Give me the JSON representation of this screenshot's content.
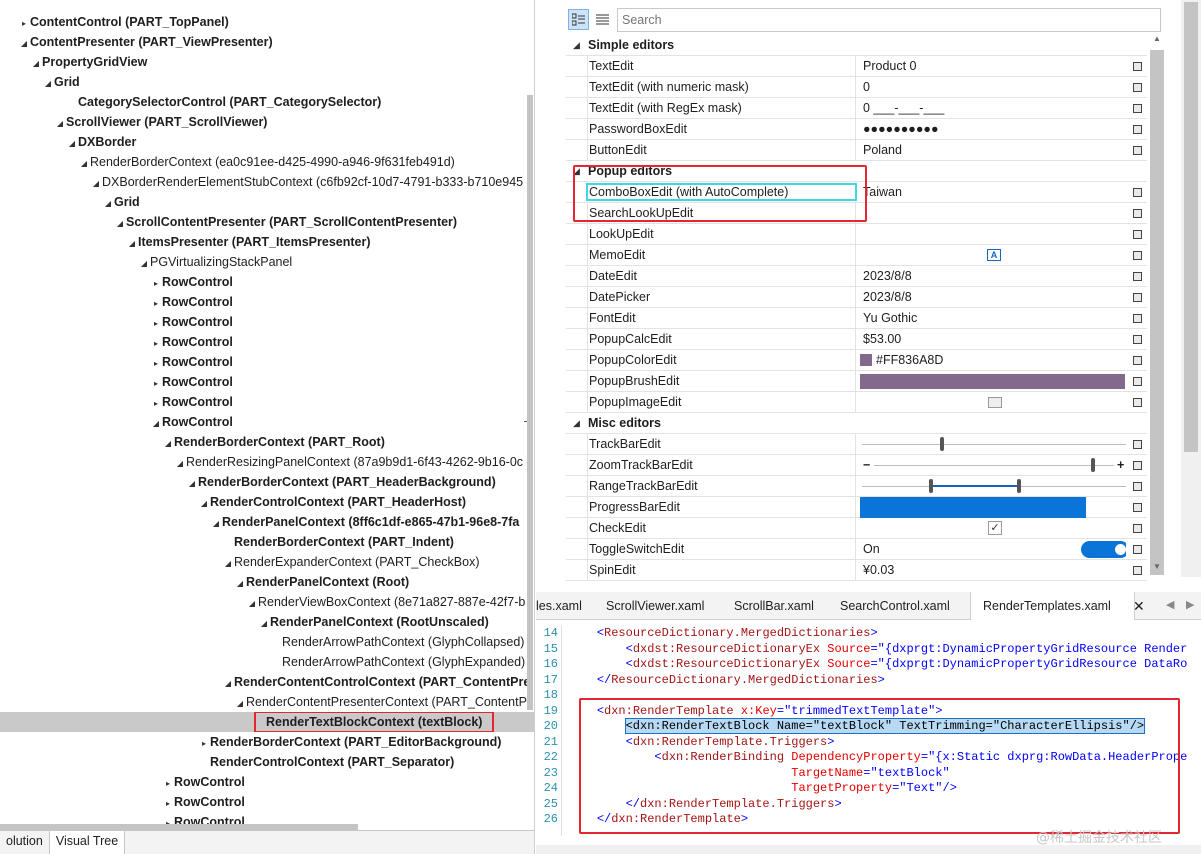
{
  "tree": {
    "nodes": [
      {
        "label": "ContentControl (PART_TopPanel)",
        "indent": 0,
        "arrow": "▸",
        "bold": true
      },
      {
        "label": "ContentPresenter (PART_ViewPresenter)",
        "indent": 0,
        "arrow": "◢",
        "bold": true
      },
      {
        "label": "PropertyGridView",
        "indent": 1,
        "arrow": "◢",
        "bold": true
      },
      {
        "label": "Grid",
        "indent": 2,
        "arrow": "◢",
        "bold": true
      },
      {
        "label": "CategorySelectorControl (PART_CategorySelector)",
        "indent": 4,
        "arrow": "",
        "bold": true
      },
      {
        "label": "ScrollViewer (PART_ScrollViewer)",
        "indent": 3,
        "arrow": "◢",
        "bold": true
      },
      {
        "label": "DXBorder",
        "indent": 4,
        "arrow": "◢",
        "bold": true
      },
      {
        "label": "RenderBorderContext (ea0c91ee-d425-4990-a946-9f631feb491d)",
        "indent": 5,
        "arrow": "◢",
        "bold": false
      },
      {
        "label": "DXBorderRenderElementStubContext (c6fb92cf-10d7-4791-b333-b710e945",
        "indent": 6,
        "arrow": "◢",
        "bold": false
      },
      {
        "label": "Grid",
        "indent": 7,
        "arrow": "◢",
        "bold": true
      },
      {
        "label": "ScrollContentPresenter (PART_ScrollContentPresenter)",
        "indent": 8,
        "arrow": "◢",
        "bold": true
      },
      {
        "label": "ItemsPresenter (PART_ItemsPresenter)",
        "indent": 9,
        "arrow": "◢",
        "bold": true
      },
      {
        "label": "PGVirtualizingStackPanel",
        "indent": 10,
        "arrow": "◢",
        "bold": false
      },
      {
        "label": "RowControl",
        "indent": 11,
        "arrow": "▸",
        "bold": true
      },
      {
        "label": "RowControl",
        "indent": 11,
        "arrow": "▸",
        "bold": true
      },
      {
        "label": "RowControl",
        "indent": 11,
        "arrow": "▸",
        "bold": true
      },
      {
        "label": "RowControl",
        "indent": 11,
        "arrow": "▸",
        "bold": true
      },
      {
        "label": "RowControl",
        "indent": 11,
        "arrow": "▸",
        "bold": true
      },
      {
        "label": "RowControl",
        "indent": 11,
        "arrow": "▸",
        "bold": true
      },
      {
        "label": "RowControl",
        "indent": 11,
        "arrow": "▸",
        "bold": true
      },
      {
        "label": "RowControl",
        "indent": 11,
        "arrow": "◢",
        "bold": true
      },
      {
        "label": "RenderBorderContext (PART_Root)",
        "indent": 12,
        "arrow": "◢",
        "bold": true
      },
      {
        "label": "RenderResizingPanelContext (87a9b9d1-6f43-4262-9b16-0c",
        "indent": 13,
        "arrow": "◢",
        "bold": false
      },
      {
        "label": "RenderBorderContext (PART_HeaderBackground)",
        "indent": 14,
        "arrow": "◢",
        "bold": true
      },
      {
        "label": "RenderControlContext (PART_HeaderHost)",
        "indent": 15,
        "arrow": "◢",
        "bold": true
      },
      {
        "label": "RenderPanelContext (8ff6c1df-e865-47b1-96e8-7fa",
        "indent": 16,
        "arrow": "◢",
        "bold": true
      },
      {
        "label": "RenderBorderContext (PART_Indent)",
        "indent": 17,
        "arrow": "",
        "bold": true
      },
      {
        "label": "RenderExpanderContext (PART_CheckBox)",
        "indent": 17,
        "arrow": "◢",
        "bold": false
      },
      {
        "label": "RenderPanelContext (Root)",
        "indent": 18,
        "arrow": "◢",
        "bold": true
      },
      {
        "label": "RenderViewBoxContext (8e71a827-887e-42f7-b",
        "indent": 19,
        "arrow": "◢",
        "bold": false
      },
      {
        "label": "RenderPanelContext (RootUnscaled)",
        "indent": 20,
        "arrow": "◢",
        "bold": true
      },
      {
        "label": "RenderArrowPathContext (GlyphCollapsed)",
        "indent": 21,
        "arrow": "",
        "bold": false
      },
      {
        "label": "RenderArrowPathContext (GlyphExpanded)",
        "indent": 21,
        "arrow": "",
        "bold": false
      },
      {
        "label": "RenderContentControlContext (PART_ContentPre",
        "indent": 17,
        "arrow": "◢",
        "bold": true
      },
      {
        "label": "RenderContentPresenterContext (PART_ContentPr",
        "indent": 18,
        "arrow": "◢",
        "bold": false
      },
      {
        "label": "RenderTextBlockContext (textBlock)",
        "indent": 19,
        "arrow": "",
        "bold": true,
        "selected": true
      },
      {
        "label": "RenderBorderContext (PART_EditorBackground)",
        "indent": 15,
        "arrow": "▸",
        "bold": true
      },
      {
        "label": "RenderControlContext (PART_Separator)",
        "indent": 15,
        "arrow": "",
        "bold": true
      },
      {
        "label": "RowControl",
        "indent": 12,
        "arrow": "▸",
        "bold": true
      },
      {
        "label": "RowControl",
        "indent": 12,
        "arrow": "▸",
        "bold": true
      },
      {
        "label": "RowControl",
        "indent": 12,
        "arrow": "▸",
        "bold": true
      }
    ]
  },
  "bottom_tabs": [
    {
      "label": "olution",
      "active": false
    },
    {
      "label": "Visual Tree",
      "active": true
    }
  ],
  "property_grid": {
    "search_placeholder": "Search",
    "rows": [
      {
        "kind": "cat",
        "label": "Simple editors"
      },
      {
        "kind": "row",
        "name": "TextEdit",
        "value": "Product 0"
      },
      {
        "kind": "row",
        "name": "TextEdit (with numeric mask)",
        "value": "0"
      },
      {
        "kind": "row",
        "name": "TextEdit (with RegEx mask)",
        "value": "0 ___-___-___"
      },
      {
        "kind": "row",
        "name": "PasswordBoxEdit",
        "value": "●●●●●●●●●●"
      },
      {
        "kind": "row",
        "name": "ButtonEdit",
        "value": "Poland"
      },
      {
        "kind": "cat",
        "label": "Popup editors"
      },
      {
        "kind": "row",
        "name": "ComboBoxEdit (with AutoComplete)",
        "value": "Taiwan"
      },
      {
        "kind": "row",
        "name": "SearchLookUpEdit",
        "value": ""
      },
      {
        "kind": "row",
        "name": "LookUpEdit",
        "value": ""
      },
      {
        "kind": "row",
        "name": "MemoEdit",
        "value": "",
        "special": "memo"
      },
      {
        "kind": "row",
        "name": "DateEdit",
        "value": "2023/8/8"
      },
      {
        "kind": "row",
        "name": "DatePicker",
        "value": "2023/8/8"
      },
      {
        "kind": "row",
        "name": "FontEdit",
        "value": "Yu Gothic"
      },
      {
        "kind": "row",
        "name": "PopupCalcEdit",
        "value": "$53.00"
      },
      {
        "kind": "row",
        "name": "PopupColorEdit",
        "value": "#FF836A8D",
        "special": "color"
      },
      {
        "kind": "row",
        "name": "PopupBrushEdit",
        "value": "",
        "special": "brush"
      },
      {
        "kind": "row",
        "name": "PopupImageEdit",
        "value": "",
        "special": "image"
      },
      {
        "kind": "cat",
        "label": "Misc editors"
      },
      {
        "kind": "row",
        "name": "TrackBarEdit",
        "value": "",
        "special": "track",
        "level": 0.3
      },
      {
        "kind": "row",
        "name": "ZoomTrackBarEdit",
        "value": "",
        "special": "zoom",
        "level": 0.87
      },
      {
        "kind": "row",
        "name": "RangeTrackBarEdit",
        "value": "",
        "special": "range",
        "range": [
          0.26,
          0.59
        ]
      },
      {
        "kind": "row",
        "name": "ProgressBarEdit",
        "value": "",
        "special": "progress",
        "level": 0.85
      },
      {
        "kind": "row",
        "name": "CheckEdit",
        "value": "✓",
        "special": "check"
      },
      {
        "kind": "row",
        "name": "ToggleSwitchEdit",
        "value": "On",
        "special": "toggle"
      },
      {
        "kind": "row",
        "name": "SpinEdit",
        "value": "¥0.03"
      }
    ],
    "accent_color": "#0a74d8",
    "swatch_color": "#836A8D"
  },
  "editor": {
    "tabs": [
      {
        "label": "les.xaml",
        "active": false
      },
      {
        "label": "ScrollViewer.xaml",
        "active": false
      },
      {
        "label": "ScrollBar.xaml",
        "active": false
      },
      {
        "label": "SearchControl.xaml",
        "active": false
      },
      {
        "label": "RenderTemplates.xaml",
        "active": true
      }
    ],
    "close_glyph": "✕",
    "lines": [
      {
        "n": "14",
        "html": "    <span class='pun'>&lt;</span><span class='tag'>ResourceDictionary.MergedDictionaries</span><span class='pun'>&gt;</span>"
      },
      {
        "n": "15",
        "html": "        <span class='pun'>&lt;</span><span class='tag'>dxdst:ResourceDictionaryEx</span> <span class='att'>Source</span><span class='pun'>=</span><span class='str'>\"{dxprgt:DynamicPropertyGridResource Render</span>"
      },
      {
        "n": "16",
        "html": "        <span class='pun'>&lt;</span><span class='tag'>dxdst:ResourceDictionaryEx</span> <span class='att'>Source</span><span class='pun'>=</span><span class='str'>\"{dxprgt:DynamicPropertyGridResource DataRo</span>"
      },
      {
        "n": "17",
        "html": "    <span class='pun'>&lt;/</span><span class='tag'>ResourceDictionary.MergedDictionaries</span><span class='pun'>&gt;</span>"
      },
      {
        "n": "18",
        "html": ""
      },
      {
        "n": "19",
        "html": "    <span class='pun'>&lt;</span><span class='tag'>dxn:RenderTemplate</span> <span class='att'>x:Key</span><span class='pun'>=</span><span class='str'>\"trimmedTextTemplate\"</span><span class='pun'>&gt;</span>"
      },
      {
        "n": "20",
        "html": "        <span class='lsel'>&lt;dxn:RenderTextBlock Name=\"textBlock\" TextTrimming=\"CharacterEllipsis\"/&gt;</span>"
      },
      {
        "n": "21",
        "html": "        <span class='pun'>&lt;</span><span class='tag'>dxn:RenderTemplate.Triggers</span><span class='pun'>&gt;</span>"
      },
      {
        "n": "22",
        "html": "            <span class='pun'>&lt;</span><span class='tag'>dxn:RenderBinding</span> <span class='att'>DependencyProperty</span><span class='pun'>=</span><span class='str'>\"{x:Static dxprg:RowData.HeaderPrope</span>"
      },
      {
        "n": "23",
        "html": "                               <span class='att'>TargetName</span><span class='pun'>=</span><span class='str'>\"textBlock\"</span>"
      },
      {
        "n": "24",
        "html": "                               <span class='att'>TargetProperty</span><span class='pun'>=</span><span class='str'>\"Text\"</span><span class='pun'>/&gt;</span>"
      },
      {
        "n": "25",
        "html": "        <span class='pun'>&lt;/</span><span class='tag'>dxn:RenderTemplate.Triggers</span><span class='pun'>&gt;</span>"
      },
      {
        "n": "26",
        "html": "    <span class='pun'>&lt;/</span><span class='tag'>dxn:RenderTemplate</span><span class='pun'>&gt;</span>"
      }
    ],
    "watermark": "@稀土掘金技术社区"
  }
}
